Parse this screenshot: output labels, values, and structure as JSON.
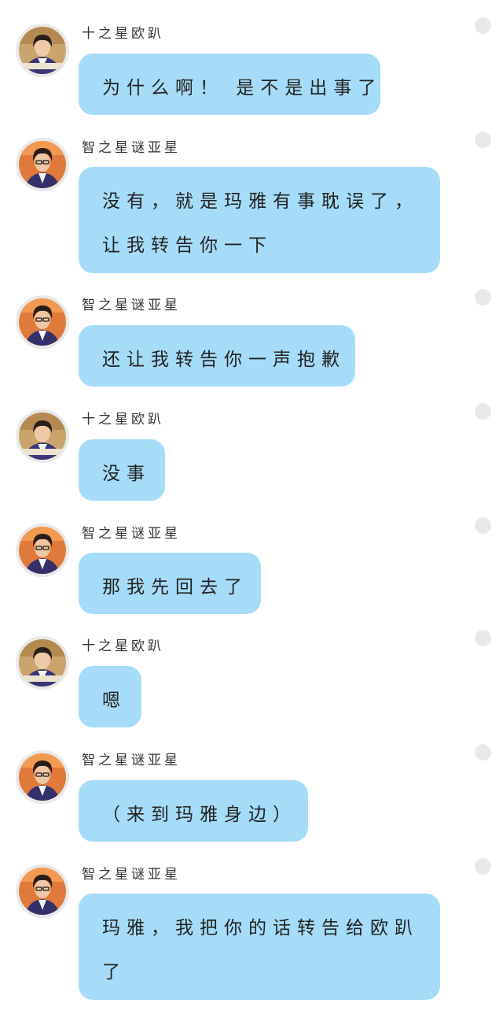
{
  "colors": {
    "background": "#ffffff",
    "bubble": "#a6dcf8",
    "avatar_ring": "#e9e9e9",
    "status_dot": "#e9e9e9",
    "text": "#222222"
  },
  "messages": [
    {
      "sender": "十之星欧趴",
      "avatar": "avatar-oupa-icon",
      "lines": [
        "为什么啊！ 是不是出事了"
      ]
    },
    {
      "sender": "智之星谜亚星",
      "avatar": "avatar-miyaxing-icon",
      "lines": [
        "没有，就是玛雅有事耽误了，",
        "让我转告你一下"
      ]
    },
    {
      "sender": "智之星谜亚星",
      "avatar": "avatar-miyaxing-icon",
      "lines": [
        "还让我转告你一声抱歉"
      ]
    },
    {
      "sender": "十之星欧趴",
      "avatar": "avatar-oupa-icon",
      "lines": [
        "没事"
      ]
    },
    {
      "sender": "智之星谜亚星",
      "avatar": "avatar-miyaxing-icon",
      "lines": [
        "那我先回去了"
      ]
    },
    {
      "sender": "十之星欧趴",
      "avatar": "avatar-oupa-icon",
      "lines": [
        "嗯"
      ]
    },
    {
      "sender": "智之星谜亚星",
      "avatar": "avatar-miyaxing-icon",
      "lines": [
        "（来到玛雅身边）"
      ]
    },
    {
      "sender": "智之星谜亚星",
      "avatar": "avatar-miyaxing-icon",
      "lines": [
        "玛雅，我把你的话转告给欧趴",
        "了"
      ]
    }
  ]
}
